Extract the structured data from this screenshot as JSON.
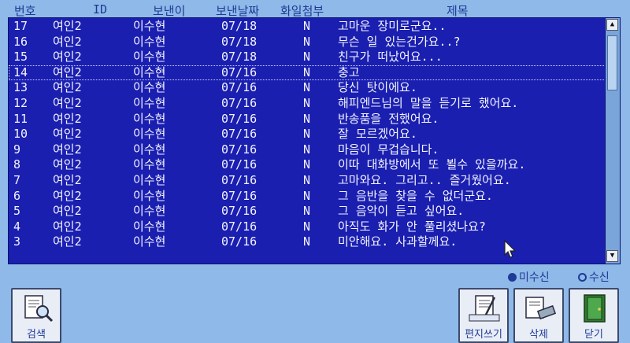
{
  "header": {
    "no": "번호",
    "id": "ID",
    "sender": "보낸이",
    "date": "보낸날짜",
    "attach": "화일첨부",
    "subject": "제목"
  },
  "rows": [
    {
      "no": "17",
      "id": "여인2",
      "sender": "이수현",
      "date": "07/18",
      "attach": "N",
      "subject": "고마운 장미로군요.."
    },
    {
      "no": "16",
      "id": "여인2",
      "sender": "이수현",
      "date": "07/18",
      "attach": "N",
      "subject": "무슨 일 있는건가요..?"
    },
    {
      "no": "15",
      "id": "여인2",
      "sender": "이수현",
      "date": "07/18",
      "attach": "N",
      "subject": "친구가 떠났어요..."
    },
    {
      "no": "14",
      "id": "여인2",
      "sender": "이수현",
      "date": "07/16",
      "attach": "N",
      "subject": "충고"
    },
    {
      "no": "13",
      "id": "여인2",
      "sender": "이수현",
      "date": "07/16",
      "attach": "N",
      "subject": "당신 탓이에요."
    },
    {
      "no": "12",
      "id": "여인2",
      "sender": "이수현",
      "date": "07/16",
      "attach": "N",
      "subject": "해피엔드님의 말을 듣기로 했어요."
    },
    {
      "no": "11",
      "id": "여인2",
      "sender": "이수현",
      "date": "07/16",
      "attach": "N",
      "subject": "반송품을 전했어요."
    },
    {
      "no": "10",
      "id": "여인2",
      "sender": "이수현",
      "date": "07/16",
      "attach": "N",
      "subject": "잘 모르겠어요."
    },
    {
      "no": "9",
      "id": "여인2",
      "sender": "이수현",
      "date": "07/16",
      "attach": "N",
      "subject": "마음이 무겁습니다."
    },
    {
      "no": "8",
      "id": "여인2",
      "sender": "이수현",
      "date": "07/16",
      "attach": "N",
      "subject": "이따 대화방에서 또 뵐수 있을까요."
    },
    {
      "no": "7",
      "id": "여인2",
      "sender": "이수현",
      "date": "07/16",
      "attach": "N",
      "subject": "고마와요. 그리고.. 즐거웠어요."
    },
    {
      "no": "6",
      "id": "여인2",
      "sender": "이수현",
      "date": "07/16",
      "attach": "N",
      "subject": "그 음반을 찾을 수 없더군요."
    },
    {
      "no": "5",
      "id": "여인2",
      "sender": "이수현",
      "date": "07/16",
      "attach": "N",
      "subject": "그 음악이 듣고 싶어요."
    },
    {
      "no": "4",
      "id": "여인2",
      "sender": "이수현",
      "date": "07/16",
      "attach": "N",
      "subject": "아직도 화가 안 풀리셨나요?"
    },
    {
      "no": "3",
      "id": "여인2",
      "sender": "이수현",
      "date": "07/16",
      "attach": "N",
      "subject": "미안해요. 사과할께요."
    }
  ],
  "selected_row": "14",
  "radio": {
    "unread": "미수신",
    "read": "수신",
    "selected": "unread"
  },
  "buttons": {
    "search": "검색",
    "compose": "편지쓰기",
    "delete": "삭제",
    "close": "닫기"
  },
  "colors": {
    "background": "#8fb9e8",
    "list_bg": "#1a1fb0",
    "text": "#f4f4ff",
    "accent": "#1e3a96"
  },
  "icons": {
    "scroll_up": "▲",
    "scroll_down": "▼"
  }
}
